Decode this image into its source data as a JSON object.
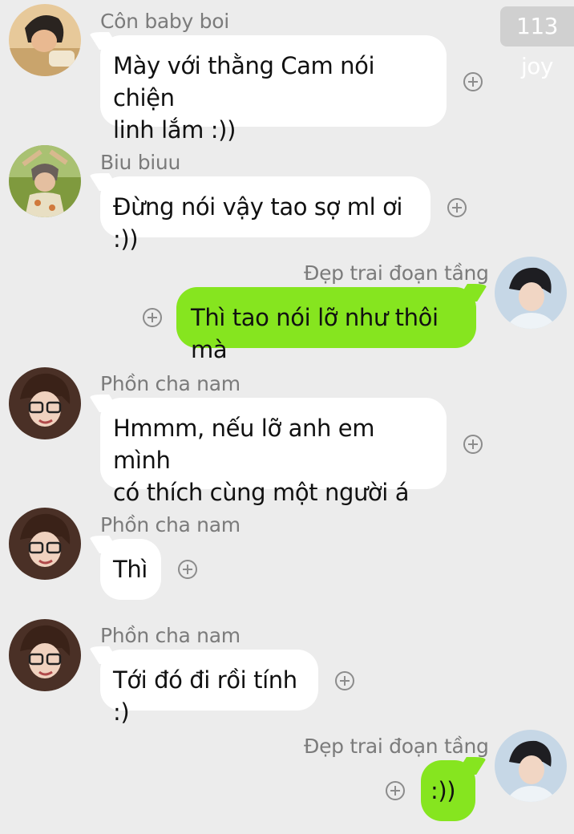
{
  "badge": "113 joy",
  "messages": [
    {
      "sender": "Côn baby boi",
      "line1": "Mày với thằng Cam nói chiện",
      "line2": "linh lắm :))"
    },
    {
      "sender": "Biu biuu",
      "line1": "Đừng nói vậy tao sợ ml ơi :))"
    },
    {
      "sender": "Đẹp trai đoạn tầng",
      "line1": "Thì tao nói lỡ như thôi mà"
    },
    {
      "sender": "Phồn cha nam",
      "line1": "Hmmm, nếu lỡ anh em mình",
      "line2": "có thích cùng một người á"
    },
    {
      "sender": "Phồn cha nam",
      "line1": "Thì"
    },
    {
      "sender": "Phồn cha nam",
      "line1": "Tới đó đi rồi tính :)"
    },
    {
      "sender": "Đẹp trai đoạn tầng",
      "line1": ":))"
    }
  ]
}
